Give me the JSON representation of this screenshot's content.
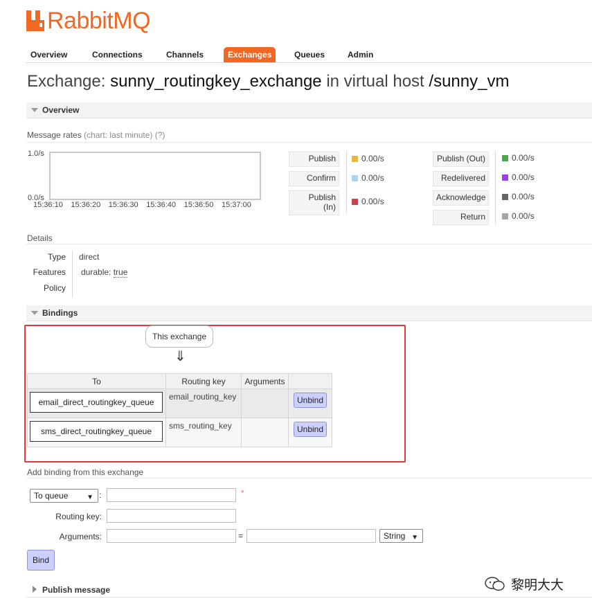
{
  "app": {
    "logo_text": "RabbitMQ"
  },
  "nav": {
    "tabs": [
      "Overview",
      "Connections",
      "Channels",
      "Exchanges",
      "Queues",
      "Admin"
    ],
    "active": "Exchanges"
  },
  "page": {
    "title_prefix": "Exchange:",
    "exchange_name": "sunny_routingkey_exchange",
    "title_mid": "in virtual host",
    "vhost": "/sunny_vm"
  },
  "overview": {
    "section_label": "Overview",
    "message_rates_label": "Message rates",
    "chart_hint": "(chart: last minute)",
    "help": "(?)",
    "y_top": "1.0/s",
    "y_bottom": "0.0/s",
    "x_ticks": [
      "15:36:10",
      "15:36:20",
      "15:36:30",
      "15:36:40",
      "15:36:50",
      "15:37:00"
    ],
    "rates_left": [
      {
        "label": "Publish",
        "value": "0.00/s",
        "color": "#e5b83a"
      },
      {
        "label": "Confirm",
        "value": "0.00/s",
        "color": "#aed3f2"
      },
      {
        "label": "Publish\n(In)",
        "value": "0.00/s",
        "color": "#c8434a"
      }
    ],
    "rates_right": [
      {
        "label": "Publish (Out)",
        "value": "0.00/s",
        "color": "#4ca64c"
      },
      {
        "label": "Redelivered",
        "value": "0.00/s",
        "color": "#9b3fe6"
      },
      {
        "label": "Acknowledge",
        "value": "0.00/s",
        "color": "#666666"
      },
      {
        "label": "Return",
        "value": "0.00/s",
        "color": "#a6a6a6"
      }
    ]
  },
  "details": {
    "label": "Details",
    "type_label": "Type",
    "type_value": "direct",
    "features_label": "Features",
    "features_key": "durable:",
    "features_value": "true",
    "policy_label": "Policy"
  },
  "bindings": {
    "section_label": "Bindings",
    "this_exchange": "This exchange",
    "arrow": "⇓",
    "columns": [
      "To",
      "Routing key",
      "Arguments",
      ""
    ],
    "rows": [
      {
        "to": "email_direct_routingkey_queue",
        "routing_key": "email_routing_key",
        "arguments": "",
        "action": "Unbind"
      },
      {
        "to": "sms_direct_routingkey_queue",
        "routing_key": "sms_routing_key",
        "arguments": "",
        "action": "Unbind"
      }
    ]
  },
  "add_binding": {
    "label": "Add binding from this exchange",
    "destination_select": "To queue",
    "required_mark": "*",
    "routing_key_label": "Routing key:",
    "arguments_label": "Arguments:",
    "equals": "=",
    "type_select": "String",
    "bind_button": "Bind",
    "colon": ":"
  },
  "publish_message": {
    "section_label": "Publish message"
  },
  "watermark": {
    "text": "黎明大大"
  }
}
